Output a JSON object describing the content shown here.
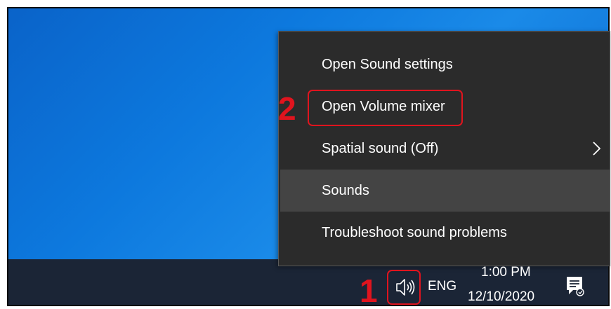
{
  "context_menu": {
    "items": [
      {
        "label": "Open Sound settings"
      },
      {
        "label": "Open Volume mixer"
      },
      {
        "label": "Spatial sound (Off)",
        "has_submenu": true
      },
      {
        "label": "Sounds"
      },
      {
        "label": "Troubleshoot sound problems"
      }
    ],
    "hovered_index": 3
  },
  "annotations": {
    "step1": "1",
    "step2": "2",
    "color": "#e0141e"
  },
  "taskbar": {
    "language": "ENG",
    "time": "1:00 PM",
    "date": "12/10/2020",
    "speaker_icon": "speaker-icon",
    "notification_icon": "action-center-icon"
  }
}
